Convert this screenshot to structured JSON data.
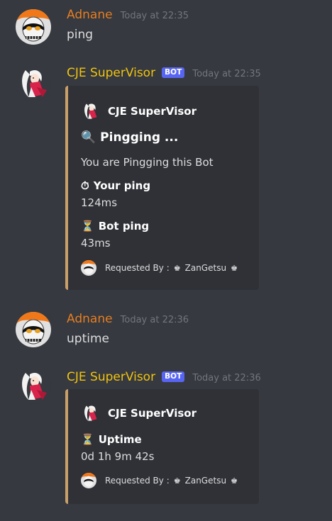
{
  "messages": [
    {
      "author": "Adnane",
      "time": "Today at 22:35",
      "text": "ping"
    },
    {
      "author": "CJE SuperVisor",
      "badge": "BOT",
      "time": "Today at 22:35",
      "embed": {
        "author": "CJE SuperVisor",
        "title": "Pingging ...",
        "title_emoji": "🔍",
        "description": "You are Pingging this Bot",
        "fields": [
          {
            "emoji": "⏱",
            "name": "Your ping",
            "value": "124ms"
          },
          {
            "emoji": "⏳",
            "name": "Bot ping",
            "value": "43ms"
          }
        ],
        "footer_prefix": "Requested By :",
        "footer_crown": "♚",
        "footer_user": "ZanGetsu"
      }
    },
    {
      "author": "Adnane",
      "time": "Today at 22:36",
      "text": "uptime"
    },
    {
      "author": "CJE SuperVisor",
      "badge": "BOT",
      "time": "Today at 22:36",
      "embed": {
        "author": "CJE SuperVisor",
        "fields": [
          {
            "emoji": "⏳",
            "name": "Uptime",
            "value": "0d 1h 9m 42s"
          }
        ],
        "footer_prefix": "Requested By :",
        "footer_crown": "♚",
        "footer_user": "ZanGetsu"
      }
    }
  ],
  "colors": {
    "background": "#36393f",
    "embed_bg": "#2f3136",
    "embed_bar": "#c9a068",
    "user_name": "#e67e22",
    "bot_name": "#f1c40f",
    "bot_badge": "#5865f2"
  },
  "icons": {
    "user_avatar": "hollow-mask-avatar",
    "bot_avatar": "anime-girl-avatar"
  }
}
